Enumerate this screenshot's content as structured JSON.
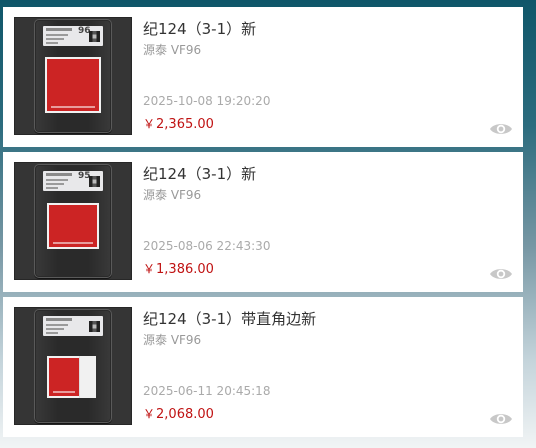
{
  "items": [
    {
      "title": "纪124（3-1）新",
      "grade": "源泰 VF96",
      "date": "2025-10-08 19:20:20",
      "currency": "￥",
      "price": "2,365.00",
      "slab_grade": "96",
      "thumb_icon": "graded-stamp-image"
    },
    {
      "title": "纪124（3-1）新",
      "grade": "源泰 VF96",
      "date": "2025-08-06 22:43:30",
      "currency": "￥",
      "price": "1,386.00",
      "slab_grade": "95",
      "thumb_icon": "graded-stamp-image"
    },
    {
      "title": "纪124（3-1）带直角边新",
      "grade": "源泰 VF96",
      "date": "2025-06-11 20:45:18",
      "currency": "￥",
      "price": "2,068.00",
      "slab_grade": "",
      "thumb_icon": "graded-stamp-image"
    }
  ],
  "icons": {
    "view": "eye-icon"
  },
  "colors": {
    "price": "#c01313",
    "stamp_red": "#cc2424",
    "eye": "#c8c8c8"
  }
}
